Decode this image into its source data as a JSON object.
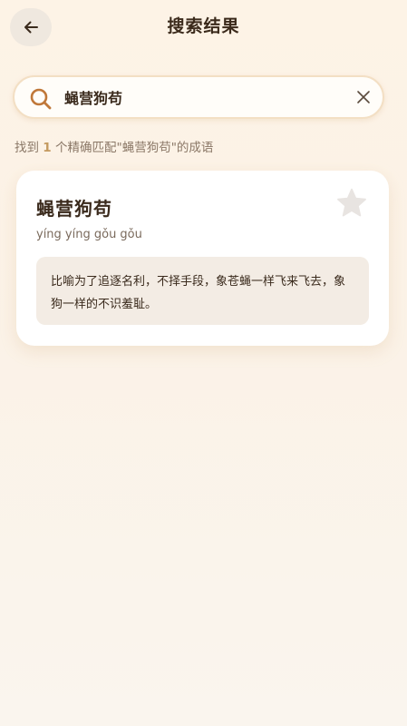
{
  "header": {
    "title": "搜索结果",
    "back_icon": "arrow-left-icon"
  },
  "search": {
    "value": "蝇营狗苟",
    "search_icon": "search-icon",
    "clear_icon": "close-icon",
    "accent_color": "#c0783a"
  },
  "summary": {
    "prefix": "找到 ",
    "count": "1",
    "suffix": " 个精确匹配\"蝇营狗苟\"的成语"
  },
  "result": {
    "idiom": "蝇营狗苟",
    "pinyin": "yíng yíng gǒu gǒu",
    "definition": "比喻为了追逐名利，不择手段，象苍蝇一样飞来飞去，象狗一样的不识羞耻。",
    "favorite_icon": "star-icon",
    "favorited": false
  }
}
